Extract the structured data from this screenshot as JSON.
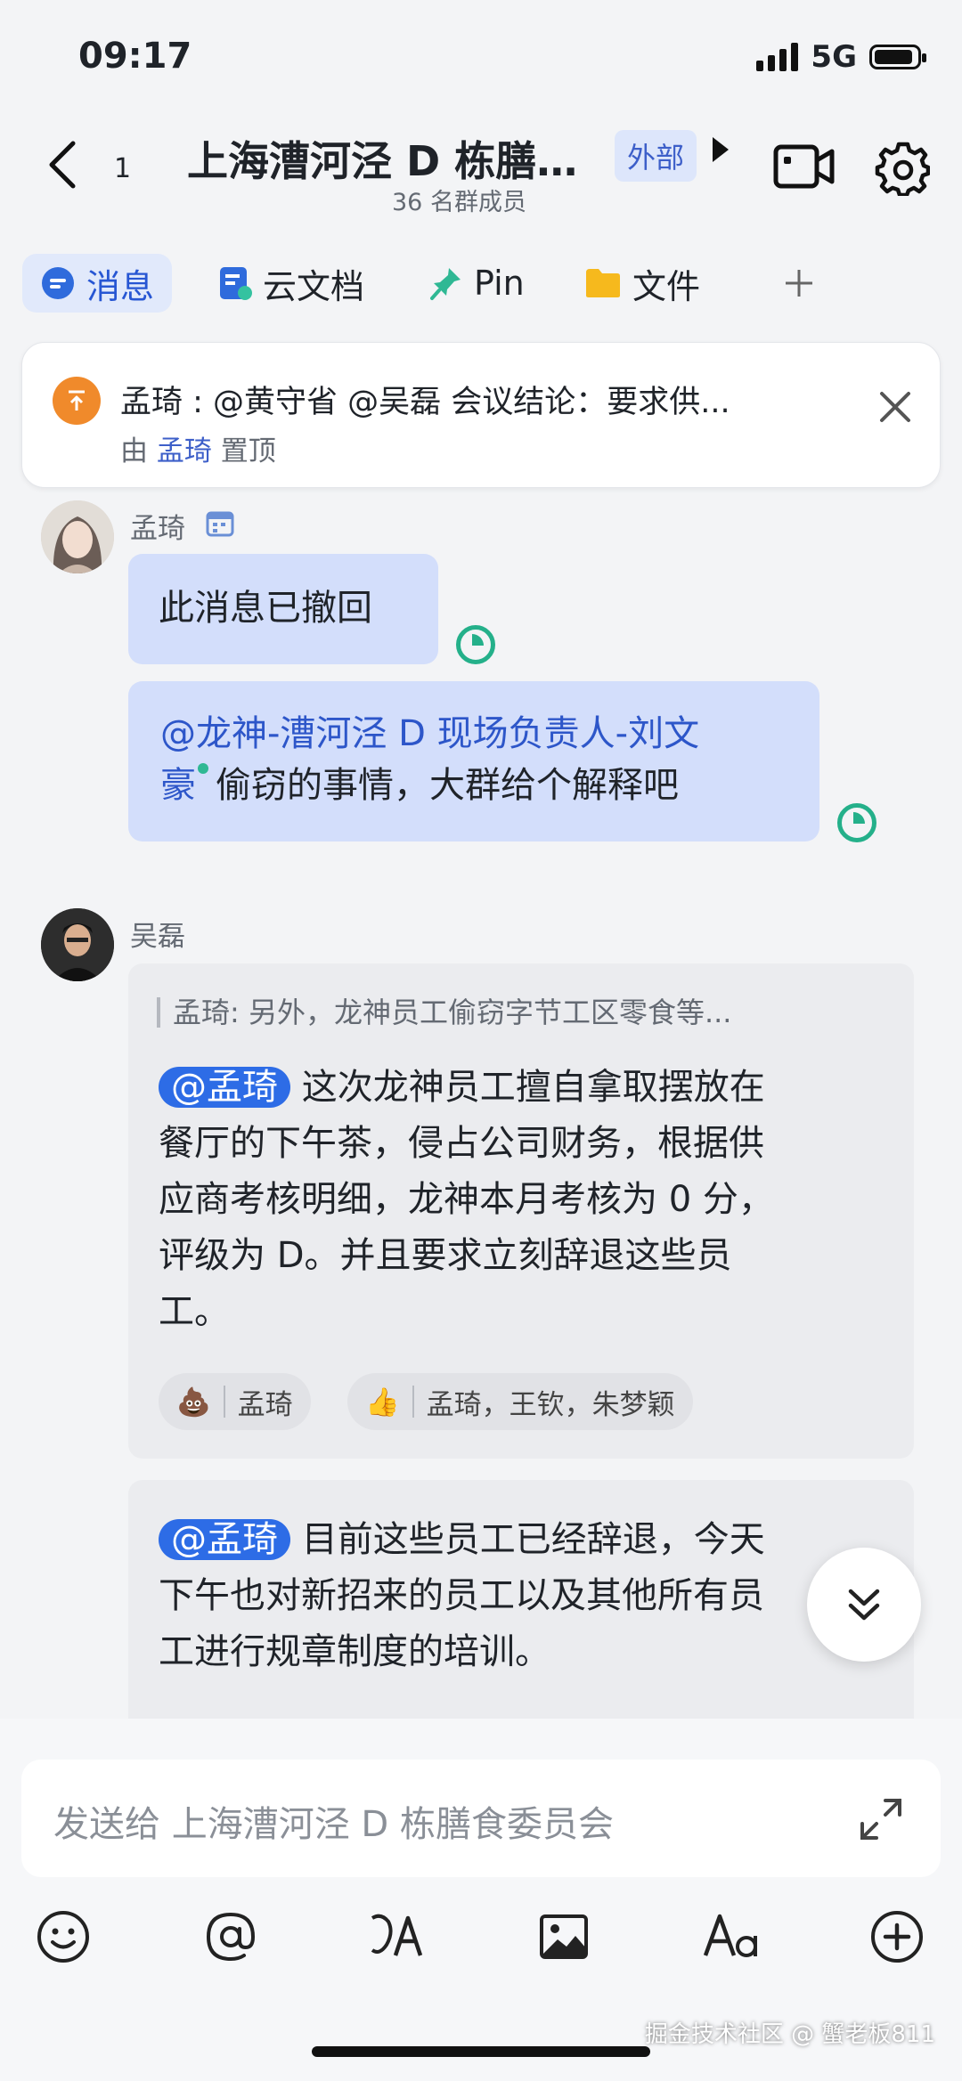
{
  "status_bar": {
    "time": "09:17",
    "network": "5G"
  },
  "header": {
    "unread_count": "1",
    "title": "上海漕河泾 D 栋膳…",
    "member_count": "36 名群成员",
    "external_tag": "外部"
  },
  "tabs": [
    {
      "label": "消息",
      "icon": "message-icon"
    },
    {
      "label": "云文档",
      "icon": "doc-icon"
    },
    {
      "label": "Pin",
      "icon": "pin-icon"
    },
    {
      "label": "文件",
      "icon": "folder-icon"
    }
  ],
  "pinned": {
    "text": "孟琦 : @黄守省 @吴磊 会议结论：要求供...",
    "by_prefix": "由",
    "by_name": "孟琦",
    "by_suffix": "置顶"
  },
  "messages": [
    {
      "sender": "孟琦",
      "recalled": "此消息已撤回",
      "mention": "@龙神-漕河泾 D 现场负责人-刘文豪",
      "mention_line1": "@龙神-漕河泾 D 现场负责人-刘文",
      "mention_line2": "豪",
      "text": "偷窃的事情，大群给个解释吧"
    },
    {
      "sender": "吴磊",
      "quote": "孟琦: 另外，龙神员工偷窃字节工区零食等...",
      "mention": "@孟琦",
      "lines": [
        "这次龙神员工擅自拿取摆放在",
        "餐厅的下午茶，侵占公司财务，根据供",
        "应商考核明细，龙神本月考核为 0 分，",
        "评级为 D。并且要求立刻辞退这些员",
        "工。"
      ],
      "reactions": [
        {
          "emoji": "💩",
          "users": "孟琦"
        },
        {
          "emoji": "👍",
          "users": "孟琦，王钦，朱梦颖"
        }
      ]
    },
    {
      "mention": "@孟琦",
      "lines": [
        "目前这些员工已经辞退，今天",
        "下午也对新招来的员工以及其他所有员",
        "工进行规章制度的培训。"
      ]
    }
  ],
  "composer": {
    "placeholder": "发送给 上海漕河泾 D 栋膳食委员会"
  },
  "toolbar": [
    "emoji-icon",
    "mention-icon",
    "translate-icon",
    "image-icon",
    "format-icon",
    "add-icon"
  ],
  "credit": "掘金技术社区 @ 蟹老板811"
}
